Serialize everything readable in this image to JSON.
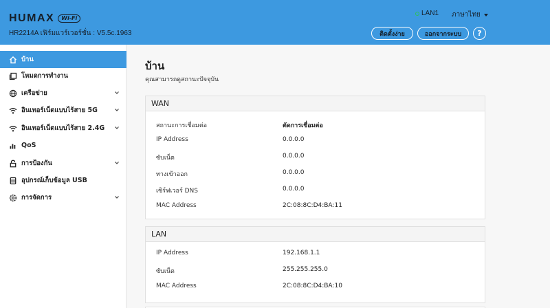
{
  "header": {
    "brand": "HUMAX",
    "badge": "Wi-Fi",
    "firmware": "HR2214A เฟิร์มแวร์เวอร์ชั่น : V5.5c.1963",
    "lan_status": "LAN1",
    "language": "ภาษาไทย",
    "setup_button": "ติดตั้งง่าย",
    "logout_button": "ออกจากระบบ",
    "help_button": "?",
    "colors": {
      "bar": "#3d99e0",
      "status_dot": "#2cc25a"
    }
  },
  "sidebar": {
    "items": [
      {
        "label": "บ้าน",
        "icon": "home-icon",
        "active": true,
        "expandable": false
      },
      {
        "label": "โหมดการทำงาน",
        "icon": "mode-icon",
        "active": false,
        "expandable": false
      },
      {
        "label": "เครือข่าย",
        "icon": "globe-icon",
        "active": false,
        "expandable": true
      },
      {
        "label": "อินเทอร์เน็ตแบบไร้สาย 5G",
        "icon": "wifi-icon",
        "active": false,
        "expandable": true
      },
      {
        "label": "อินเทอร์เน็ตแบบไร้สาย 2.4G",
        "icon": "wifi-icon",
        "active": false,
        "expandable": true
      },
      {
        "label": "QoS",
        "icon": "bar-chart-icon",
        "active": false,
        "expandable": false
      },
      {
        "label": "การป้องกัน",
        "icon": "lock-icon",
        "active": false,
        "expandable": true
      },
      {
        "label": "อุปกรณ์เก็บข้อมูล USB",
        "icon": "usb-storage-icon",
        "active": false,
        "expandable": false
      },
      {
        "label": "การจัดการ",
        "icon": "gear-icon",
        "active": false,
        "expandable": true
      }
    ]
  },
  "main": {
    "title": "บ้าน",
    "subtitle": "คุณสามารถดูสถานะปัจจุบัน",
    "wan": {
      "heading": "WAN",
      "rows": [
        {
          "label": "สถานะการเชื่อมต่อ",
          "value": "ตัดการเชื่อมต่อ"
        },
        {
          "label": "IP Address",
          "value": "0.0.0.0"
        },
        {
          "label": "ซับเน็ต",
          "value": "0.0.0.0"
        },
        {
          "label": "ทางเข้าออก",
          "value": "0.0.0.0"
        },
        {
          "label": "เซิร์ฟเวอร์ DNS",
          "value": "0.0.0.0"
        },
        {
          "label": "MAC Address",
          "value": "2C:08:8C:D4:BA:11"
        }
      ]
    },
    "lan": {
      "heading": "LAN",
      "rows": [
        {
          "label": "IP Address",
          "value": "192.168.1.1"
        },
        {
          "label": "ซับเน็ต",
          "value": "255.255.255.0"
        },
        {
          "label": "MAC Address",
          "value": "2C:08:8C:D4:BA:10"
        }
      ]
    }
  }
}
